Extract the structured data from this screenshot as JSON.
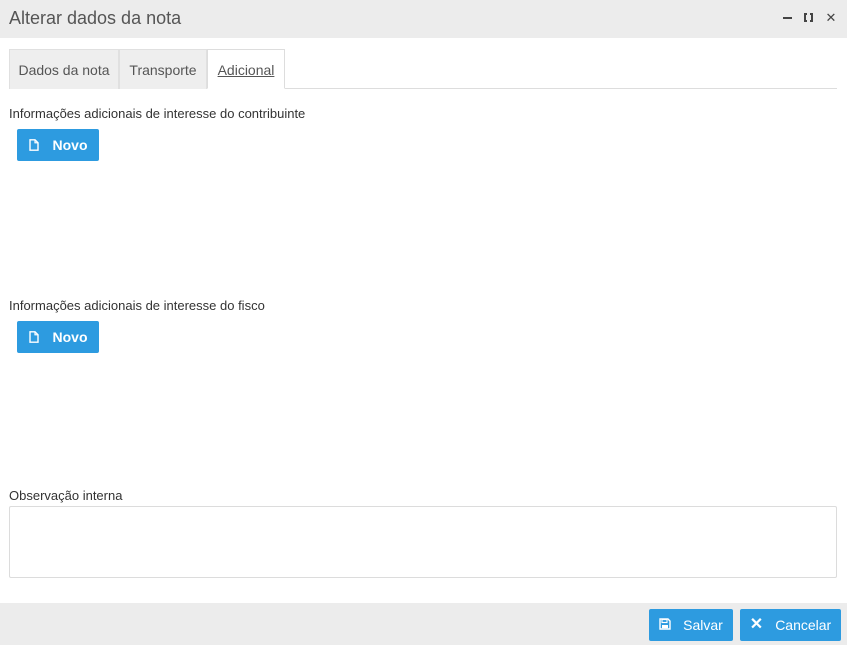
{
  "window": {
    "title": "Alterar dados da nota",
    "controls": [
      "minimize-icon",
      "maximize-icon",
      "close-icon"
    ]
  },
  "tabs": [
    {
      "label": "Dados da nota",
      "active": false
    },
    {
      "label": "Transporte",
      "active": false
    },
    {
      "label": "Adicional",
      "active": true
    }
  ],
  "sections": {
    "contribuinte": {
      "label": "Informações adicionais de interesse do contribuinte",
      "button_label": "Novo",
      "button_icon": "document-icon"
    },
    "fisco": {
      "label": "Informações adicionais de interesse do fisco",
      "button_label": "Novo",
      "button_icon": "document-icon"
    },
    "observacao": {
      "label": "Observação interna",
      "value": ""
    }
  },
  "footer": {
    "save_label": "Salvar",
    "save_icon": "save-icon",
    "cancel_label": "Cancelar",
    "cancel_icon": "close-icon"
  },
  "colors": {
    "accent": "#2d9be0",
    "titlebar_bg": "#ececec"
  }
}
